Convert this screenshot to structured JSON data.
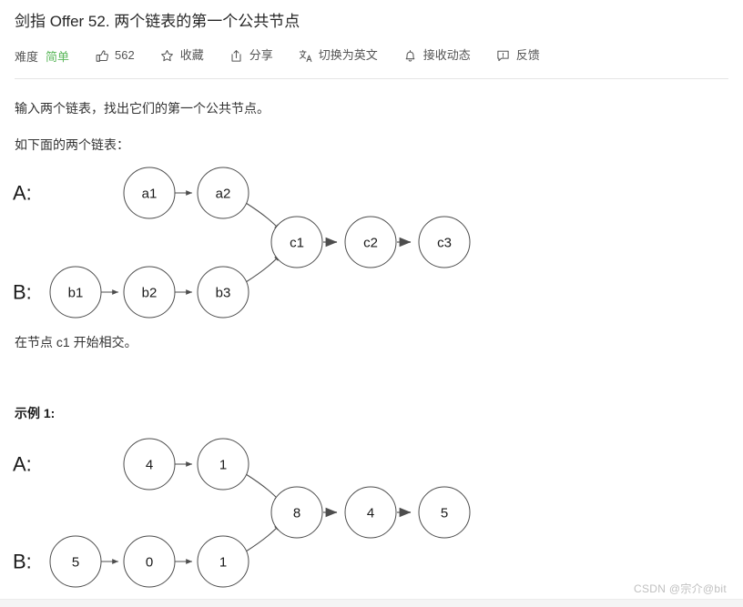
{
  "header": {
    "title": "剑指 Offer 52. 两个链表的第一个公共节点",
    "difficulty_label": "难度",
    "difficulty_value": "简单",
    "difficulty_color": "#5cb85c",
    "actions": [
      {
        "icon": "thumbs-up-icon",
        "label": "562"
      },
      {
        "icon": "star-icon",
        "label": "收藏"
      },
      {
        "icon": "share-icon",
        "label": "分享"
      },
      {
        "icon": "translate-icon",
        "label": "切换为英文"
      },
      {
        "icon": "bell-icon",
        "label": "接收动态"
      },
      {
        "icon": "feedback-icon",
        "label": "反馈"
      }
    ]
  },
  "content": {
    "intro": "输入两个链表，找出它们的第一个公共节点。",
    "as_follows": "如下面的两个链表：",
    "intersect_note": "在节点 c1 开始相交。",
    "example_heading": "示例 1:"
  },
  "diagram_one": {
    "label_a": "A:",
    "label_b": "B:",
    "list_a": [
      "a1",
      "a2"
    ],
    "list_b": [
      "b1",
      "b2",
      "b3"
    ],
    "list_common": [
      "c1",
      "c2",
      "c3"
    ]
  },
  "diagram_two": {
    "label_a": "A:",
    "label_b": "B:",
    "list_a": [
      "4",
      "1"
    ],
    "list_b": [
      "5",
      "0",
      "1"
    ],
    "list_common": [
      "8",
      "4",
      "5"
    ]
  },
  "watermark": {
    "text": "CSDN @宗介@bit"
  }
}
